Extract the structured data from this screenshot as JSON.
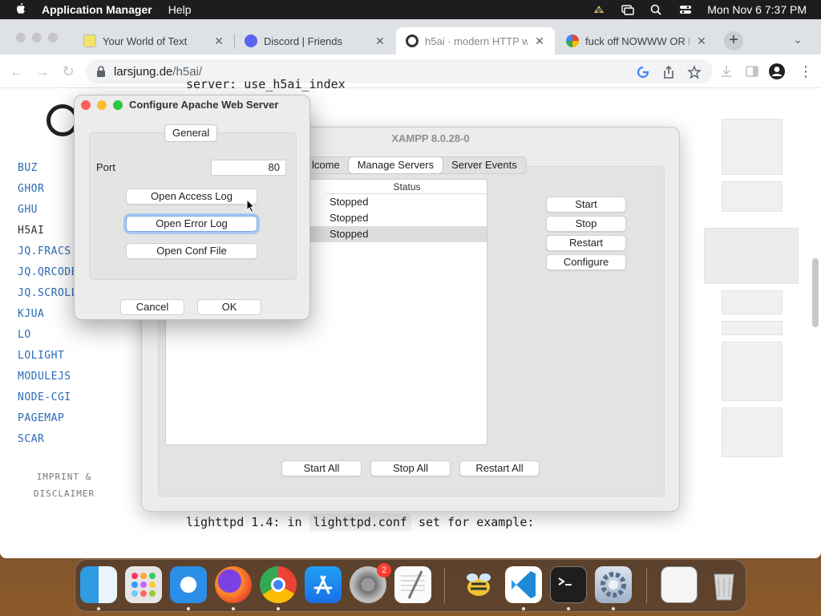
{
  "menubar": {
    "app_name": "Application Manager",
    "items": [
      "Help"
    ],
    "clock": "Mon Nov 6  7:37 PM"
  },
  "browser": {
    "tabs": [
      {
        "title": "Your World of Text",
        "active": false
      },
      {
        "title": "Discord | Friends",
        "active": false
      },
      {
        "title": "h5ai · modern HTTP w",
        "active": true
      },
      {
        "title": "fuck off NOWWW OR I",
        "active": false
      }
    ],
    "new_tab_label": "+",
    "url_domain": "larsjung.de",
    "url_path": "/h5ai/"
  },
  "page": {
    "sidebar_links": [
      "BUZ",
      "GHOR",
      "GHU",
      "H5AI",
      "JQ.FRACS",
      "JQ.QRCODE",
      "JQ.SCROLL",
      "KJUA",
      "LO",
      "LOLIGHT",
      "MODULEJS",
      "NODE-CGI",
      "PAGEMAP",
      "SCAR"
    ],
    "current_link": "H5AI",
    "imprint_line1": "IMPRINT &",
    "imprint_line2": "DISCLAIMER",
    "code_top": "server: use_h5ai_index",
    "code_prefix": "lighttpd 1.4: in ",
    "code_chip": "lighttpd.conf",
    "code_suffix": " set for example:"
  },
  "xampp": {
    "title": "XAMPP 8.0.28-0",
    "tabs": [
      "lcome",
      "Manage Servers",
      "Server Events"
    ],
    "selected_tab": "Manage Servers",
    "list_header": "Status",
    "rows": [
      "Stopped",
      "Stopped",
      "Stopped"
    ],
    "side_buttons": [
      "Start",
      "Stop",
      "Restart",
      "Configure"
    ],
    "bottom_buttons": [
      "Start All",
      "Stop All",
      "Restart All"
    ]
  },
  "dialog": {
    "title": "Configure Apache Web Server",
    "tab": "General",
    "port_label": "Port",
    "port_value": "80",
    "buttons": [
      "Open Access Log",
      "Open Error Log",
      "Open Conf File"
    ],
    "cancel": "Cancel",
    "ok": "OK"
  },
  "dock": {
    "apps": [
      "finder-icon",
      "launchpad-icon",
      "safari-icon",
      "firefox-icon",
      "chrome-icon",
      "app-store-icon",
      "system-preferences-icon",
      "textedit-icon",
      "xampp-bee-icon",
      "vscode-icon",
      "terminal-icon",
      "xampp-manager-icon",
      "preview-icon",
      "trash-icon"
    ],
    "badge": "2"
  },
  "colors": {
    "link_blue": "#2a6ab4",
    "focus_ring": "#a6c8f2",
    "badge_red": "#ff3b30"
  }
}
